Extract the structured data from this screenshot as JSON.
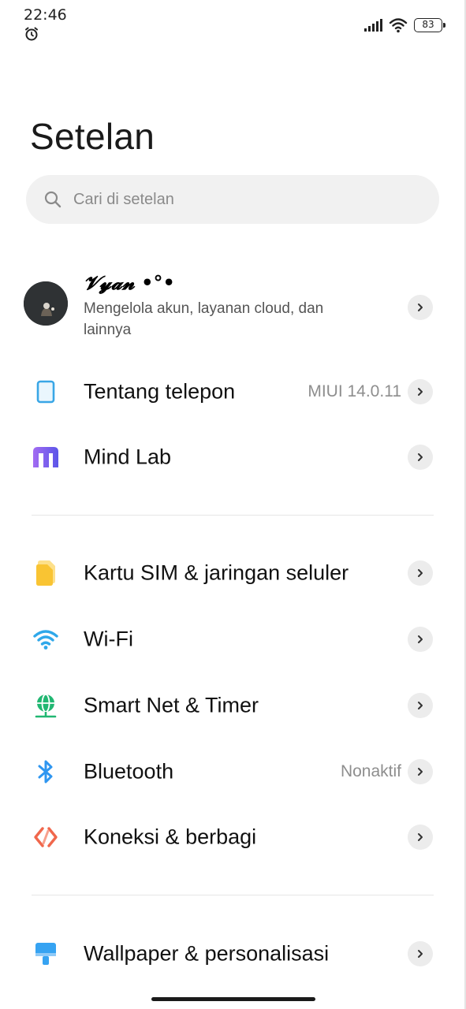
{
  "status_bar": {
    "time": "22:46",
    "battery_level": "83",
    "icons": [
      "alarm-icon",
      "signal-icon",
      "wifi-icon",
      "battery-icon"
    ]
  },
  "page": {
    "title": "Setelan"
  },
  "search": {
    "placeholder": "Cari di setelan"
  },
  "account": {
    "name": "𝓥𝔂𝓪𝓷 •°•",
    "subtitle": "Mengelola akun, layanan cloud, dan lainnya"
  },
  "items": [
    {
      "label": "Tentang telepon",
      "value": "MIUI 14.0.11",
      "icon": "phone-icon",
      "color": "#39a6e6"
    },
    {
      "label": "Mind Lab",
      "value": "",
      "icon": "mind-lab-icon",
      "color": "#8a5cf0"
    },
    {
      "label": "Kartu SIM & jaringan seluler",
      "value": "",
      "icon": "sim-card-icon",
      "color": "#f9c433"
    },
    {
      "label": "Wi-Fi",
      "value": "",
      "icon": "wifi-icon",
      "color": "#2fa8ea"
    },
    {
      "label": "Smart Net & Timer",
      "value": "",
      "icon": "globe-icon",
      "color": "#21b772"
    },
    {
      "label": "Bluetooth",
      "value": "Nonaktif",
      "icon": "bluetooth-icon",
      "color": "#2f96f0"
    },
    {
      "label": "Koneksi & berbagi",
      "value": "",
      "icon": "share-connection-icon",
      "color": "#f0674c"
    },
    {
      "label": "Wallpaper & personalisasi",
      "value": "",
      "icon": "paintbrush-icon",
      "color": "#36a3f2"
    }
  ]
}
